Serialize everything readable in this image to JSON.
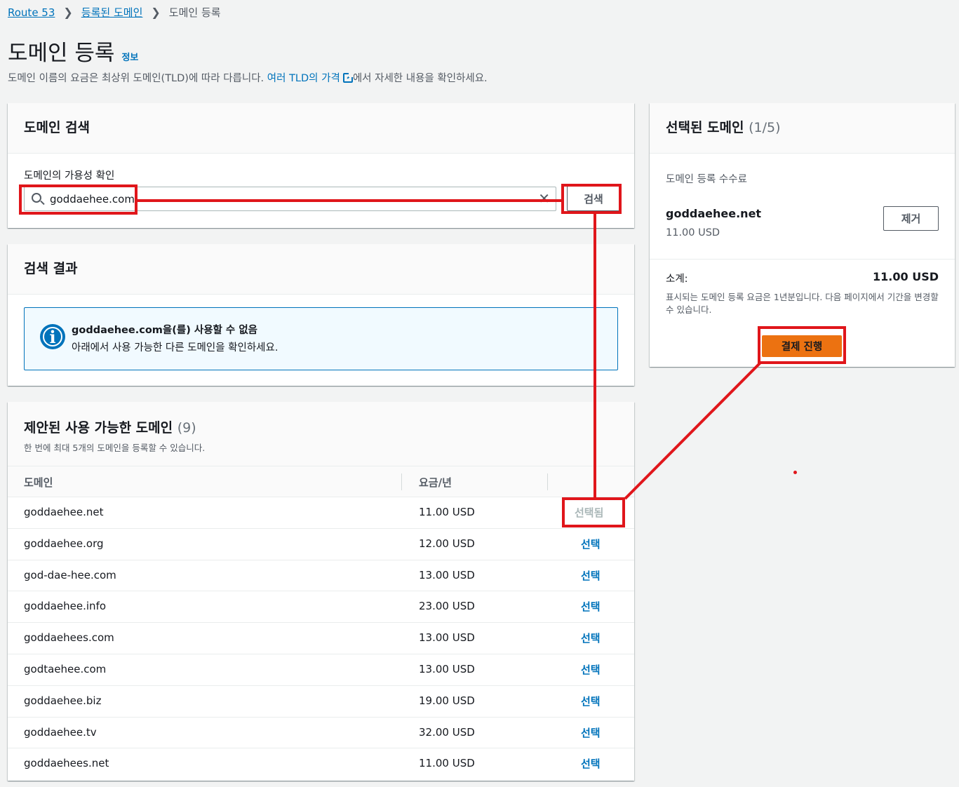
{
  "breadcrumb": {
    "items": [
      "Route 53",
      "등록된 도메인",
      "도메인 등록"
    ]
  },
  "header": {
    "title": "도메인 등록",
    "info_label": "정보",
    "description_pre": "도메인 이름의 요금은 최상위 도메인(TLD)에 따라 다릅니다. ",
    "description_link": "여러 TLD의 가격",
    "description_post": "에서 자세한 내용을 확인하세요."
  },
  "search": {
    "panel_title": "도메인 검색",
    "field_label": "도메인의 가용성 확인",
    "input_value": "goddaehee.com",
    "button_label": "검색"
  },
  "results": {
    "panel_title": "검색 결과",
    "alert_title": "goddaehee.com을(를) 사용할 수 없음",
    "alert_message": "아래에서 사용 가능한 다른 도메인을 확인하세요."
  },
  "suggested": {
    "title": "제안된 사용 가능한 도메인",
    "count": "(9)",
    "subtitle": "한 번에 최대 5개의 도메인을 등록할 수 있습니다.",
    "columns": [
      "도메인",
      "요금/년"
    ],
    "rows": [
      {
        "domain": "goddaehee.net",
        "price": "11.00 USD",
        "action": "선택됨",
        "selected": true
      },
      {
        "domain": "goddaehee.org",
        "price": "12.00 USD",
        "action": "선택",
        "selected": false
      },
      {
        "domain": "god-dae-hee.com",
        "price": "13.00 USD",
        "action": "선택",
        "selected": false
      },
      {
        "domain": "goddaehee.info",
        "price": "23.00 USD",
        "action": "선택",
        "selected": false
      },
      {
        "domain": "goddaehees.com",
        "price": "13.00 USD",
        "action": "선택",
        "selected": false
      },
      {
        "domain": "godtaehee.com",
        "price": "13.00 USD",
        "action": "선택",
        "selected": false
      },
      {
        "domain": "goddaehee.biz",
        "price": "19.00 USD",
        "action": "선택",
        "selected": false
      },
      {
        "domain": "goddaehee.tv",
        "price": "32.00 USD",
        "action": "선택",
        "selected": false
      },
      {
        "domain": "goddaehees.net",
        "price": "11.00 USD",
        "action": "선택",
        "selected": false
      }
    ]
  },
  "selected": {
    "title": "선택된 도메인",
    "count": "(1/5)",
    "fee_label": "도메인 등록 수수료",
    "domain": "goddaehee.net",
    "price": "11.00 USD",
    "remove_label": "제거",
    "subtotal_label": "소계:",
    "subtotal_value": "11.00 USD",
    "note": "표시되는 도메인 등록 요금은 1년분입니다. 다음 페이지에서 기간을 변경할 수 있습니다.",
    "checkout_label": "결제 진행"
  },
  "colors": {
    "link": "#0073bb",
    "primary_button": "#ec7211",
    "annotation": "#e0161b"
  }
}
